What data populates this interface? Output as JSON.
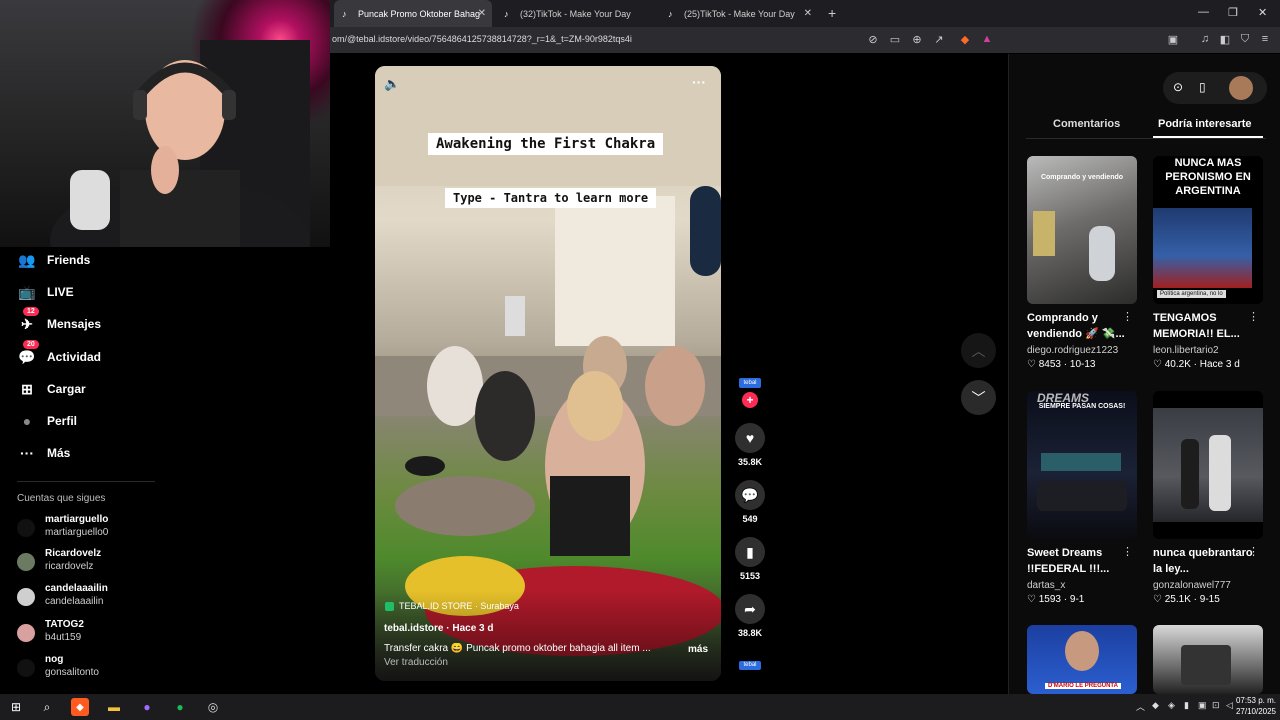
{
  "browser": {
    "tabs": [
      {
        "title": "Puncak Promo Oktober Bahag",
        "active": true
      },
      {
        "title": "(32)TikTok - Make Your Day",
        "active": false
      },
      {
        "title": "(25)TikTok - Make Your Day",
        "active": false
      }
    ],
    "url": "om/@tebal.idstore/video/7564864125738814728?_r=1&_t=ZM-90r982tqs4i"
  },
  "sidebar": {
    "items": [
      {
        "label": "Friends",
        "icon": "friends-icon",
        "glyph": "👥"
      },
      {
        "label": "LIVE",
        "icon": "live-icon",
        "glyph": "📺"
      },
      {
        "label": "Mensajes",
        "icon": "messages-icon",
        "glyph": "✈",
        "badge": "12"
      },
      {
        "label": "Actividad",
        "icon": "activity-icon",
        "glyph": "💬",
        "badge": "20"
      },
      {
        "label": "Cargar",
        "icon": "upload-icon",
        "glyph": "⊞"
      },
      {
        "label": "Perfil",
        "icon": "profile-icon",
        "glyph": "●"
      },
      {
        "label": "Más",
        "icon": "more-icon",
        "glyph": "···"
      }
    ],
    "following_title": "Cuentas que sigues",
    "following": [
      {
        "name": "martiarguello",
        "handle": "martiarguello0"
      },
      {
        "name": "Ricardovelz",
        "handle": "ricardovelz"
      },
      {
        "name": "candelaaailin",
        "handle": "candelaaailin"
      },
      {
        "name": "TATOG2",
        "handle": "b4ut159"
      },
      {
        "name": "nog",
        "handle": "gonsalitonto"
      }
    ]
  },
  "video": {
    "overlay_title": "Awakening the First Chakra",
    "overlay_sub": "Type - Tantra to learn more",
    "location": "TEBAL.ID STORE · Surabaya",
    "author_line": "tebal.idstore · Hace 3 d",
    "caption": "Transfer cakra 😄 Puncak promo oktober bahagia all item ...",
    "more": "más",
    "translate": "Ver traducción"
  },
  "actions": {
    "avatar_label": "tebal",
    "likes": "35.8K",
    "comments": "549",
    "saves": "5153",
    "shares": "38.8K",
    "footer_label": "tebal"
  },
  "right_panel": {
    "tabs": [
      "Comentarios",
      "Podría interesarte"
    ],
    "cards": [
      {
        "title": "Comprando y vendiendo 🚀 💸...",
        "author": "diego.rodriguez1223",
        "stats": "♡ 8453 · 10-13",
        "thumb_text": "Comprando y vendiendo"
      },
      {
        "title": "TENGAMOS MEMORIA!! EL...",
        "author": "leon.libertario2",
        "stats": "♡ 40.2K · Hace 3 d",
        "thumb_text": "NUNCA MAS PERONISMO EN ARGENTINA",
        "thumb_small": "Política argentina, no lo"
      },
      {
        "title": "Sweet Dreams !!FEDERAL !!!...",
        "author": "dartas_x",
        "stats": "♡ 1593 · 9-1",
        "thumb_text": "SIEMPRE PASAN COSAS!",
        "thumb_big": "DREAMS"
      },
      {
        "title": "nunca quebrantaro la ley...",
        "author": "gonzalonawel777",
        "stats": "♡ 25.1K · 9-15"
      },
      {
        "thumb_text": "D'MARIO LE PREGUNTA"
      },
      {}
    ]
  },
  "taskbar": {
    "time": "07:53 p. m.",
    "date": "27/10/2025"
  },
  "colors": {
    "accent": "#fe2c55",
    "background": "#000000",
    "panel": "#0b0b0b"
  }
}
